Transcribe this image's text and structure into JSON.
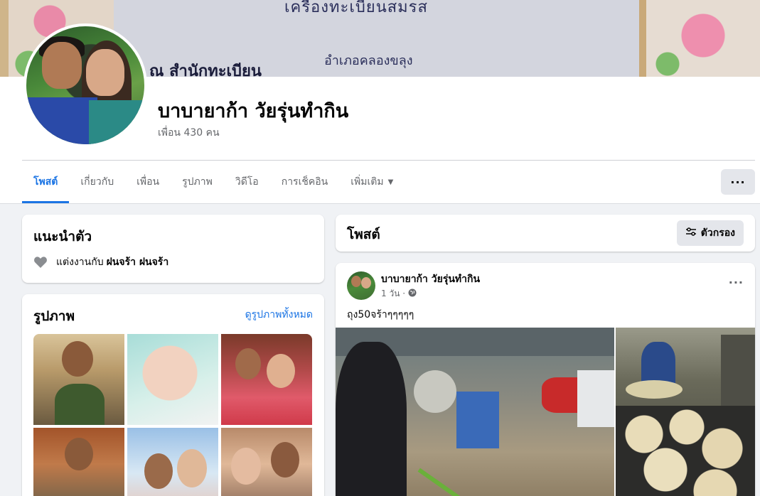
{
  "cover": {
    "text_top": "เครื่องทะเบียนสมรส",
    "text_office": "ณ  สำนักทะเบียน",
    "text_district": "อำเภอคลองขลุง"
  },
  "profile": {
    "name": "บาบายาก้า วัยรุ่นทำกิน",
    "friends": "เพื่อน 430 คน"
  },
  "tabs": [
    {
      "label": "โพสต์",
      "active": true
    },
    {
      "label": "เกี่ยวกับ"
    },
    {
      "label": "เพื่อน"
    },
    {
      "label": "รูปภาพ"
    },
    {
      "label": "วิดีโอ"
    },
    {
      "label": "การเช็คอิน"
    },
    {
      "label": "เพิ่มเติม"
    }
  ],
  "more_button": "···",
  "intro": {
    "title": "แนะนำตัว",
    "relationship_prefix": "แต่งงานกับ",
    "relationship_name": "ฝนจร้า ฝนจร้า",
    "icon": "heart-icon"
  },
  "photos": {
    "title": "รูปภาพ",
    "see_all": "ดูรูปภาพทั้งหมด"
  },
  "posts": {
    "title": "โพสต์",
    "filter_label": "ตัวกรอง"
  },
  "post": {
    "author": "บาบายาก้า วัยรุ่นทำกิน",
    "time": "1 วัน ·",
    "text": "ถุง50จร้าๆๆๆๆๆ",
    "more": "···"
  },
  "colors": {
    "accent": "#1b74e4",
    "background": "#f0f2f5",
    "secondary_text": "#65676b"
  }
}
